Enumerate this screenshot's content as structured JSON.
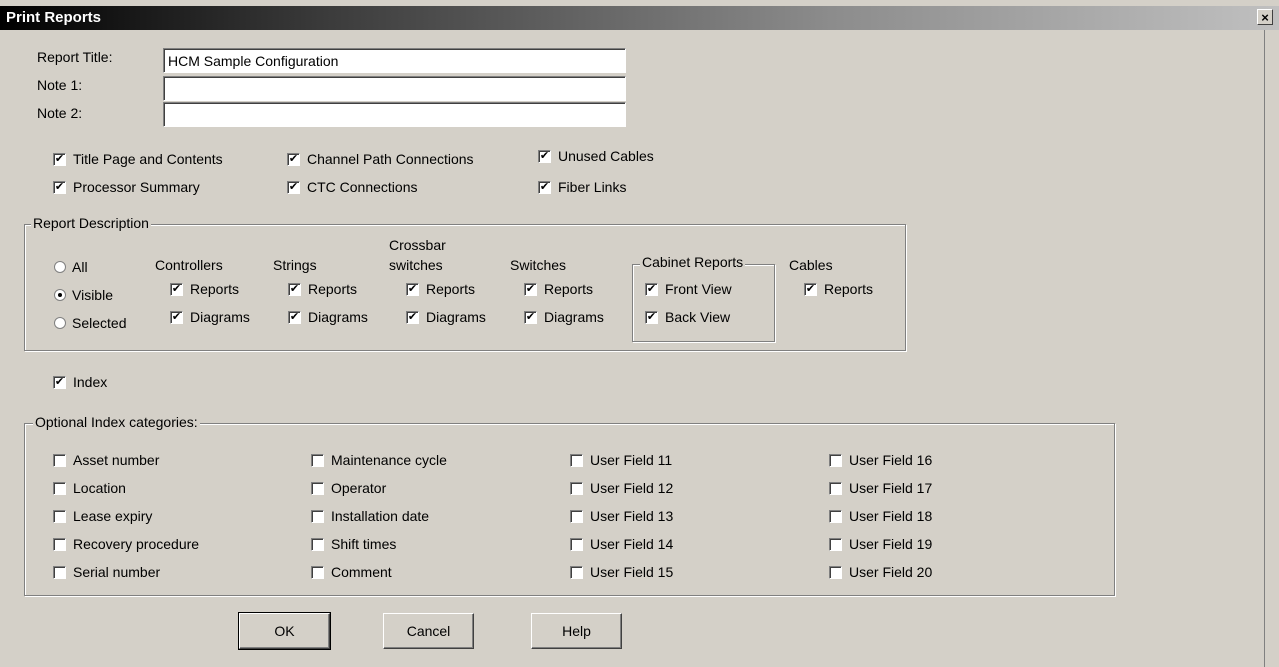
{
  "window": {
    "title": "Print Reports",
    "close_glyph": "×"
  },
  "fields": {
    "report_title": {
      "label": "Report Title:",
      "value": "HCM Sample Configuration"
    },
    "note1": {
      "label": "Note 1:",
      "value": ""
    },
    "note2": {
      "label": "Note 2:",
      "value": ""
    }
  },
  "options": {
    "title_page": {
      "label": "Title Page and Contents",
      "checked": true
    },
    "processor_summary": {
      "label": "Processor Summary",
      "checked": true
    },
    "channel_path": {
      "label": "Channel Path Connections",
      "checked": true
    },
    "ctc": {
      "label": "CTC Connections",
      "checked": true
    },
    "unused_cables": {
      "label": "Unused Cables",
      "checked": true
    },
    "fiber_links": {
      "label": "Fiber Links",
      "checked": true
    }
  },
  "report_description": {
    "legend": "Report Description",
    "radios": {
      "all": "All",
      "visible": "Visible",
      "selected": "Selected",
      "selected_value": "visible"
    },
    "headers": {
      "controllers": "Controllers",
      "strings": "Strings",
      "crossbar_line1": "Crossbar",
      "crossbar_line2": "switches",
      "switches": "Switches",
      "cabinet": "Cabinet Reports",
      "cables": "Cables"
    },
    "reports_label": "Reports",
    "diagrams_label": "Diagrams",
    "front_view": "Front View",
    "back_view": "Back View"
  },
  "index": {
    "label": "Index",
    "checked": true
  },
  "optional_index": {
    "legend": "Optional Index categories:",
    "col1": [
      "Asset number",
      "Location",
      "Lease expiry",
      "Recovery procedure",
      "Serial number"
    ],
    "col2": [
      "Maintenance cycle",
      "Operator",
      "Installation date",
      "Shift times",
      "Comment"
    ],
    "col3": [
      "User Field 11",
      "User Field 12",
      "User Field 13",
      "User Field 14",
      "User Field 15"
    ],
    "col4": [
      "User Field 16",
      "User Field 17",
      "User Field 18",
      "User Field 19",
      "User Field 20"
    ]
  },
  "buttons": {
    "ok": "OK",
    "cancel": "Cancel",
    "help": "Help"
  },
  "check_glyph": "✔"
}
